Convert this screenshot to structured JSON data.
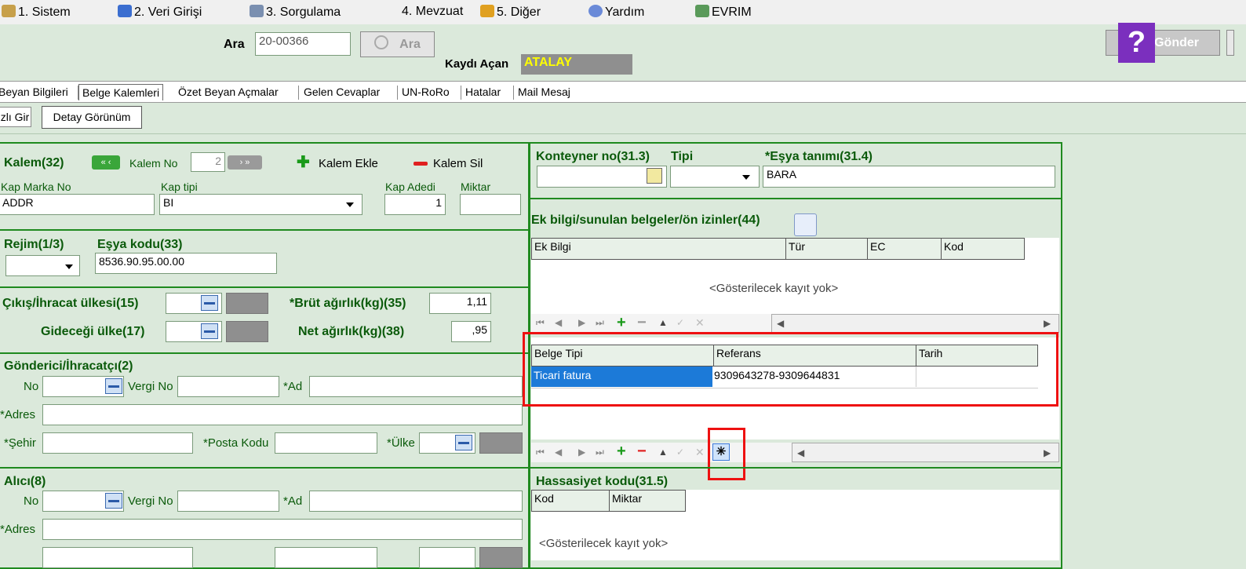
{
  "menu": {
    "items": [
      {
        "label": "1. Sistem"
      },
      {
        "label": "2. Veri Girişi"
      },
      {
        "label": "3. Sorgulama"
      },
      {
        "label": "4. Mevzuat"
      },
      {
        "label": "5. Diğer"
      },
      {
        "label": "Yardım"
      },
      {
        "label": "EVRIM"
      }
    ]
  },
  "search": {
    "label": "Ara",
    "value": "20-00366",
    "button": "Ara"
  },
  "opener": {
    "label": "Kaydı Açan",
    "value": "ATALAY"
  },
  "gonder": {
    "label": "Gönder",
    "help": "?"
  },
  "tabs": [
    {
      "label": "Beyan Bilgileri"
    },
    {
      "label": "Belge Kalemleri"
    },
    {
      "label": "Özet Beyan Açmalar"
    },
    {
      "label": "Gelen Cevaplar"
    },
    {
      "label": "UN-RoRo"
    },
    {
      "label": "Hatalar"
    },
    {
      "label": "Mail Mesaj"
    }
  ],
  "subtabs": {
    "hizli": "zlı Gir",
    "detay": "Detay Görünüm"
  },
  "kalem": {
    "title": "Kalem(32)",
    "no_label": "Kalem No",
    "no_value": "2",
    "add": "Kalem Ekle",
    "remove": "Kalem Sil",
    "kap_marka_label": "Kap Marka No",
    "kap_marka_value": "ADDR",
    "kap_tipi_label": "Kap tipi",
    "kap_tipi_value": "BI",
    "kap_adedi_label": "Kap Adedi",
    "kap_adedi_value": "1",
    "miktar_label": "Miktar",
    "miktar_value": ""
  },
  "rejim": {
    "label": "Rejim(1/3)",
    "esya_kodu_label": "Eşya kodu(33)",
    "esya_kodu_value": "8536.90.95.00.00"
  },
  "ulke": {
    "cikis_label": "Çıkış/İhracat ülkesi(15)",
    "gidecegi_label": "Gideceği ülke(17)",
    "brut_label": "*Brüt ağırlık(kg)(35)",
    "brut_value": "1,11",
    "net_label": "Net ağırlık(kg)(38)",
    "net_value": ",95"
  },
  "gonderici": {
    "title": "Gönderici/İhracatçı(2)",
    "no": "No",
    "vergi": "Vergi No",
    "ad": "*Ad",
    "adres": "*Adres",
    "sehir": "*Şehir",
    "posta": "*Posta Kodu",
    "ulke": "*Ülke"
  },
  "alici": {
    "title": "Alıcı(8)",
    "no": "No",
    "vergi": "Vergi No",
    "ad": "*Ad",
    "adres": "*Adres"
  },
  "konteyner": {
    "label": "Konteyner no(31.3)",
    "tipi": "Tipi",
    "esya_label": "*Eşya tanımı(31.4)",
    "esya_value": "BARA"
  },
  "ekbilgi": {
    "title": "Ek bilgi/sunulan belgeler/ön izinler(44)",
    "columns": [
      "Ek Bilgi",
      "Tür",
      "EC",
      "Kod"
    ],
    "empty": "<Gösterilecek kayıt yok>"
  },
  "belge": {
    "columns": [
      "Belge Tipi",
      "Referans",
      "Tarih"
    ],
    "rows": [
      {
        "tip": "Ticari fatura",
        "ref": "9309643278-9309644831",
        "tarih": ""
      }
    ]
  },
  "nav": {
    "first": "⏮",
    "prev": "◀",
    "next": "▶",
    "last": "⏭",
    "add": "+",
    "del": "−",
    "up": "▲",
    "ok": "✓",
    "cancel": "✕",
    "star": "✳",
    "scroll_left": "◀",
    "scroll_right": "▶"
  },
  "hassasiyet": {
    "title": "Hassasiyet kodu(31.5)",
    "columns": [
      "Kod",
      "Miktar"
    ],
    "empty": "<Gösterilecek kayıt yok>"
  },
  "colors": {
    "panel_border": "#1f8a1f",
    "highlight": "#e11111",
    "selection": "#1c7ad8",
    "opener_bg": "#8f8f8f",
    "opener_text": "#ffff00"
  }
}
